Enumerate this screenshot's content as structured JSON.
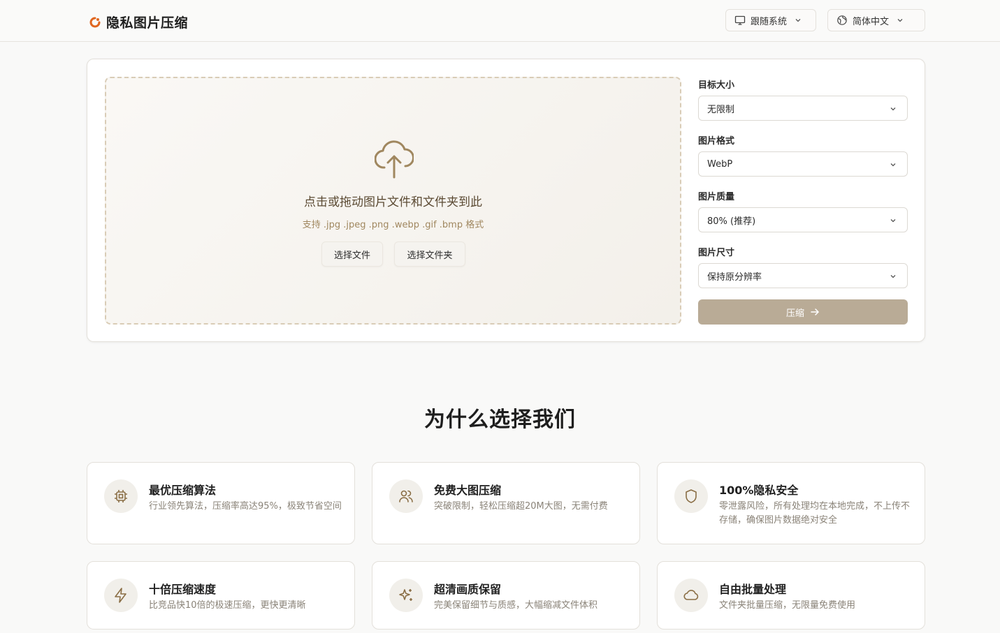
{
  "header": {
    "app_title": "隐私图片压缩",
    "theme_select": "跟随系统",
    "language_select": "简体中文"
  },
  "upload": {
    "title": "点击或拖动图片文件和文件夹到此",
    "subtitle": "支持 .jpg .jpeg .png .webp .gif .bmp 格式",
    "select_file": "选择文件",
    "select_folder": "选择文件夹"
  },
  "settings": {
    "target_size": {
      "label": "目标大小",
      "value": "无限制"
    },
    "format": {
      "label": "图片格式",
      "value": "WebP"
    },
    "quality": {
      "label": "图片质量",
      "value": "80% (推荐)"
    },
    "dimension": {
      "label": "图片尺寸",
      "value": "保持原分辨率"
    },
    "compress_button": "压缩"
  },
  "why": {
    "title": "为什么选择我们",
    "features": [
      {
        "icon": "cpu-icon",
        "title": "最优压缩算法",
        "desc": "行业领先算法，压缩率高达95%，极致节省空间"
      },
      {
        "icon": "users-icon",
        "title": "免费大图压缩",
        "desc": "突破限制，轻松压缩超20M大图，无需付费"
      },
      {
        "icon": "shield-icon",
        "title": "100%隐私安全",
        "desc": "零泄露风险，所有处理均在本地完成，不上传不存储，确保图片数据绝对安全"
      },
      {
        "icon": "zap-icon",
        "title": "十倍压缩速度",
        "desc": "比竞品快10倍的极速压缩，更快更清晰"
      },
      {
        "icon": "sparkles-icon",
        "title": "超清画质保留",
        "desc": "完美保留细节与质感，大幅缩减文件体积"
      },
      {
        "icon": "cloud-icon",
        "title": "自由批量处理",
        "desc": "文件夹批量压缩，无限量免费使用"
      }
    ]
  },
  "colors": {
    "accent": "#b9ab96",
    "brand_orange": "#e0661f",
    "icon_brown": "#a0875f"
  }
}
